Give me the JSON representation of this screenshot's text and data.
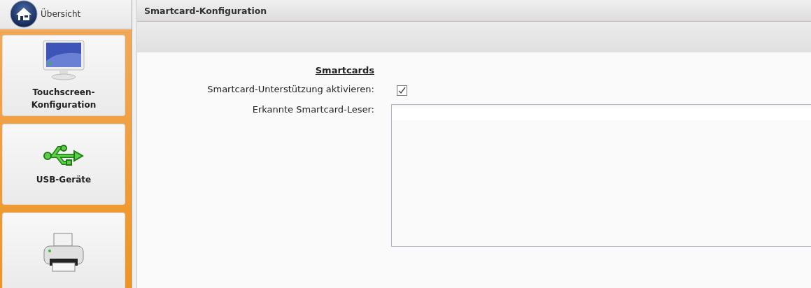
{
  "sidebar": {
    "home": {
      "label": "Übersicht"
    },
    "tiles": [
      {
        "kind": "monitor",
        "label": "Touchscreen-Konfiguration"
      },
      {
        "kind": "usb",
        "label": "USB-Geräte"
      },
      {
        "kind": "printer"
      }
    ]
  },
  "panel": {
    "title": "Smartcard-Konfiguration",
    "section": "Smartcards",
    "fields": [
      {
        "kind": "checkbox",
        "label": "Smartcard-Unterstützung aktivieren:",
        "checked": true
      },
      {
        "kind": "listbox",
        "label": "Erkannte Smartcard-Leser:"
      }
    ]
  }
}
